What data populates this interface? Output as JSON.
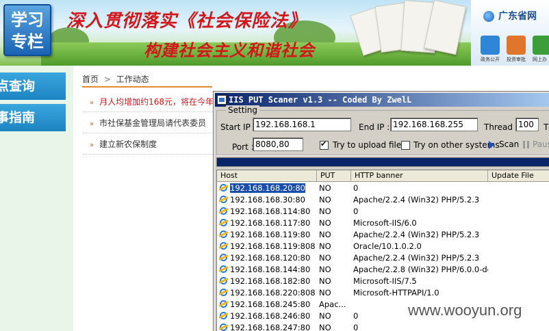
{
  "banner": {
    "badge": [
      "学习",
      "专栏"
    ],
    "slogan_line1": "深入贯彻落实《社会保险法》",
    "slogan_line2": "构建社会主义和谐社会",
    "gd_title": "广东省网",
    "gd_icons": [
      {
        "label": "政务公开",
        "color": "#2f86d6",
        "icon": "document-icon"
      },
      {
        "label": "投资审批",
        "color": "#e0762b",
        "icon": "person-icon"
      },
      {
        "label": "网上办",
        "color": "#3c9d3b",
        "icon": "person-icon"
      }
    ]
  },
  "sidebar": {
    "items": [
      {
        "label": "查询",
        "prefix": "点"
      },
      {
        "label": "指南",
        "prefix": "事"
      }
    ]
  },
  "breadcrumb": {
    "home": "首页",
    "separator": ">",
    "current": "工作动态"
  },
  "news": [
    {
      "text": "月人均增加约168元，将在今年",
      "hot": true
    },
    {
      "text": "市社保基金管理局请代表委员",
      "hot": false
    },
    {
      "text": "建立新农保制度",
      "hot": false
    }
  ],
  "scanner": {
    "title": "IIS PUT Scaner v1.3 -- Coded By ZwelL",
    "setting_label": "Setting",
    "start_ip_label": "Start IP :",
    "start_ip": "192.168.168.1",
    "end_ip_label": "End IP :",
    "end_ip": "192.168.168.255",
    "thread_label": "Thread :",
    "thread": "100",
    "thread_extra": "T",
    "port_label": "Port :",
    "port": "8080,80",
    "try_upload_label": "Try to upload file",
    "try_upload_checked": true,
    "try_other_label": "Try on other systems",
    "try_other_checked": false,
    "scan_label": "Scan",
    "pause_label": "Paus",
    "columns": [
      "Host",
      "PUT",
      "HTTP banner",
      "Update File"
    ],
    "rows": [
      {
        "host": "192.168.168.20:80",
        "put": "NO",
        "banner": "0",
        "update": "",
        "selected": true
      },
      {
        "host": "192.168.168.30:80",
        "put": "NO",
        "banner": "Apache/2.2.4 (Win32) PHP/5.2.3",
        "update": ""
      },
      {
        "host": "192.168.168.114:80",
        "put": "NO",
        "banner": "0",
        "update": ""
      },
      {
        "host": "192.168.168.117:80",
        "put": "NO",
        "banner": "Microsoft-IIS/6.0",
        "update": ""
      },
      {
        "host": "192.168.168.119:80",
        "put": "NO",
        "banner": "Apache/2.2.4 (Win32) PHP/5.2.3",
        "update": ""
      },
      {
        "host": "192.168.168.119:8080",
        "put": "NO",
        "banner": "Oracle/10.1.0.2.0",
        "update": ""
      },
      {
        "host": "192.168.168.120:80",
        "put": "NO",
        "banner": "Apache/2.2.4 (Win32) PHP/5.2.3",
        "update": ""
      },
      {
        "host": "192.168.168.144:80",
        "put": "NO",
        "banner": "Apache/2.2.8 (Win32) PHP/6.0.0-dev",
        "update": ""
      },
      {
        "host": "192.168.168.182:80",
        "put": "NO",
        "banner": "Microsoft-IIS/7.5",
        "update": ""
      },
      {
        "host": "192.168.168.220:8080",
        "put": "NO",
        "banner": "Microsoft-HTTPAPI/1.0",
        "update": ""
      },
      {
        "host": "192.168.168.245:80",
        "put": "Apac...",
        "banner": "",
        "update": ""
      },
      {
        "host": "192.168.168.246:80",
        "put": "NO",
        "banner": "0",
        "update": ""
      },
      {
        "host": "192.168.168.247:80",
        "put": "NO",
        "banner": "0",
        "update": ""
      }
    ]
  },
  "watermark": "www.wooyun.org"
}
